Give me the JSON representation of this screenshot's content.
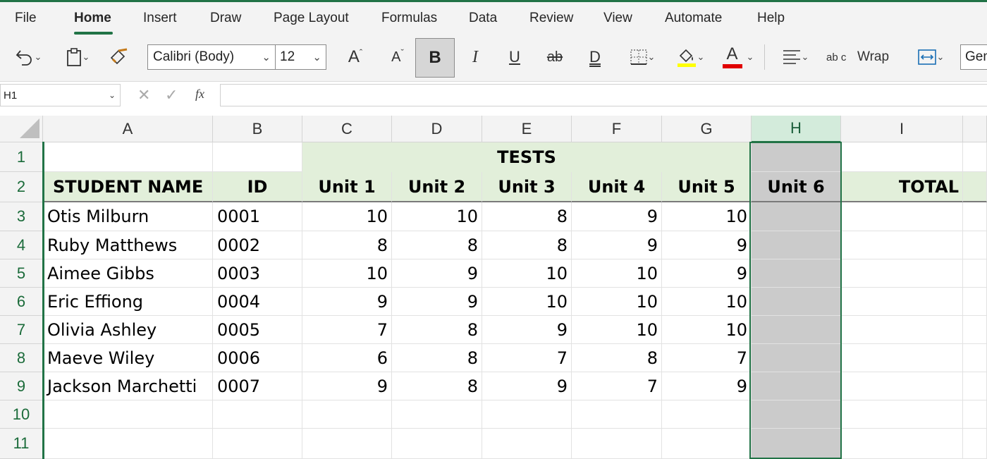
{
  "menu": {
    "tabs": [
      "File",
      "Home",
      "Insert",
      "Draw",
      "Page Layout",
      "Formulas",
      "Data",
      "Review",
      "View",
      "Automate",
      "Help"
    ],
    "active": "Home"
  },
  "ribbon": {
    "font_name": "Calibri (Body)",
    "font_size": "12",
    "bold_label": "B",
    "italic_label": "I",
    "underline_label": "U",
    "strike_label": "ab",
    "double_underline_label": "D",
    "wrap_label": "Wrap",
    "wrap_icon_label": "ab c",
    "number_format": "Gen",
    "grow_font_label": "A",
    "shrink_font_label": "A",
    "font_color_label": "A",
    "highlight_color": "#ffff00",
    "font_color": "#e00000"
  },
  "formula_bar": {
    "name_box": "H1",
    "fx_label": "fx",
    "value": ""
  },
  "sheet": {
    "columns": [
      "A",
      "B",
      "C",
      "D",
      "E",
      "F",
      "G",
      "H",
      "I"
    ],
    "selected_column": "H",
    "row_numbers": [
      "1",
      "2",
      "3",
      "4",
      "5",
      "6",
      "7",
      "8",
      "9",
      "10",
      "11"
    ],
    "merged_title": "TESTS",
    "headers": [
      "STUDENT NAME",
      "ID",
      "Unit 1",
      "Unit 2",
      "Unit 3",
      "Unit 4",
      "Unit 5",
      "Unit 6",
      "TOTAL"
    ],
    "rows": [
      {
        "name": "Otis Milburn",
        "id": "0001",
        "u1": "10",
        "u2": "10",
        "u3": "8",
        "u4": "9",
        "u5": "10"
      },
      {
        "name": "Ruby Matthews",
        "id": "0002",
        "u1": "8",
        "u2": "8",
        "u3": "8",
        "u4": "9",
        "u5": "9"
      },
      {
        "name": "Aimee Gibbs",
        "id": "0003",
        "u1": "10",
        "u2": "9",
        "u3": "10",
        "u4": "10",
        "u5": "9"
      },
      {
        "name": "Eric Effiong",
        "id": "0004",
        "u1": "9",
        "u2": "9",
        "u3": "10",
        "u4": "10",
        "u5": "10"
      },
      {
        "name": "Olivia Ashley",
        "id": "0005",
        "u1": "7",
        "u2": "8",
        "u3": "9",
        "u4": "10",
        "u5": "10"
      },
      {
        "name": "Maeve Wiley",
        "id": "0006",
        "u1": "6",
        "u2": "8",
        "u3": "7",
        "u4": "8",
        "u5": "7"
      },
      {
        "name": "Jackson Marchetti",
        "id": "0007",
        "u1": "9",
        "u2": "8",
        "u3": "9",
        "u4": "7",
        "u5": "9"
      }
    ],
    "header_fill": "#e2efda",
    "selected_fill": "#cbcbcb",
    "accent": "#217346"
  }
}
